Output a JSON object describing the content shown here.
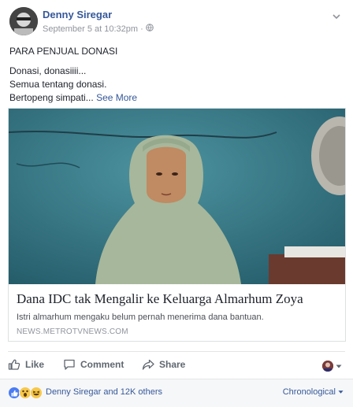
{
  "post": {
    "author": "Denny Siregar",
    "timestamp": "September 5 at 10:32pm",
    "separator": "·",
    "privacy_icon": "globe-icon",
    "text_lines": [
      "PARA PENJUAL DONASI",
      "Donasi, donasiiii...",
      "Semua tentang donasi.",
      "Bertopeng simpati..."
    ],
    "see_more": "See More"
  },
  "link": {
    "title": "Dana IDC tak Mengalir ke Keluarga Almarhum Zoya",
    "description": "Istri almarhum mengaku belum pernah menerima dana bantuan.",
    "domain": "NEWS.METROTVNEWS.COM"
  },
  "actions": {
    "like": "Like",
    "comment": "Comment",
    "share": "Share"
  },
  "reactions": {
    "types": [
      "like",
      "wow",
      "haha"
    ],
    "summary": "Denny Siregar and 12K others",
    "sort_label": "Chronological"
  },
  "colors": {
    "link_blue": "#365899",
    "meta_gray": "#90949c",
    "action_gray": "#606770",
    "like_blue": "#4a7cf3",
    "emoji_yellow": "#f7c84a"
  }
}
